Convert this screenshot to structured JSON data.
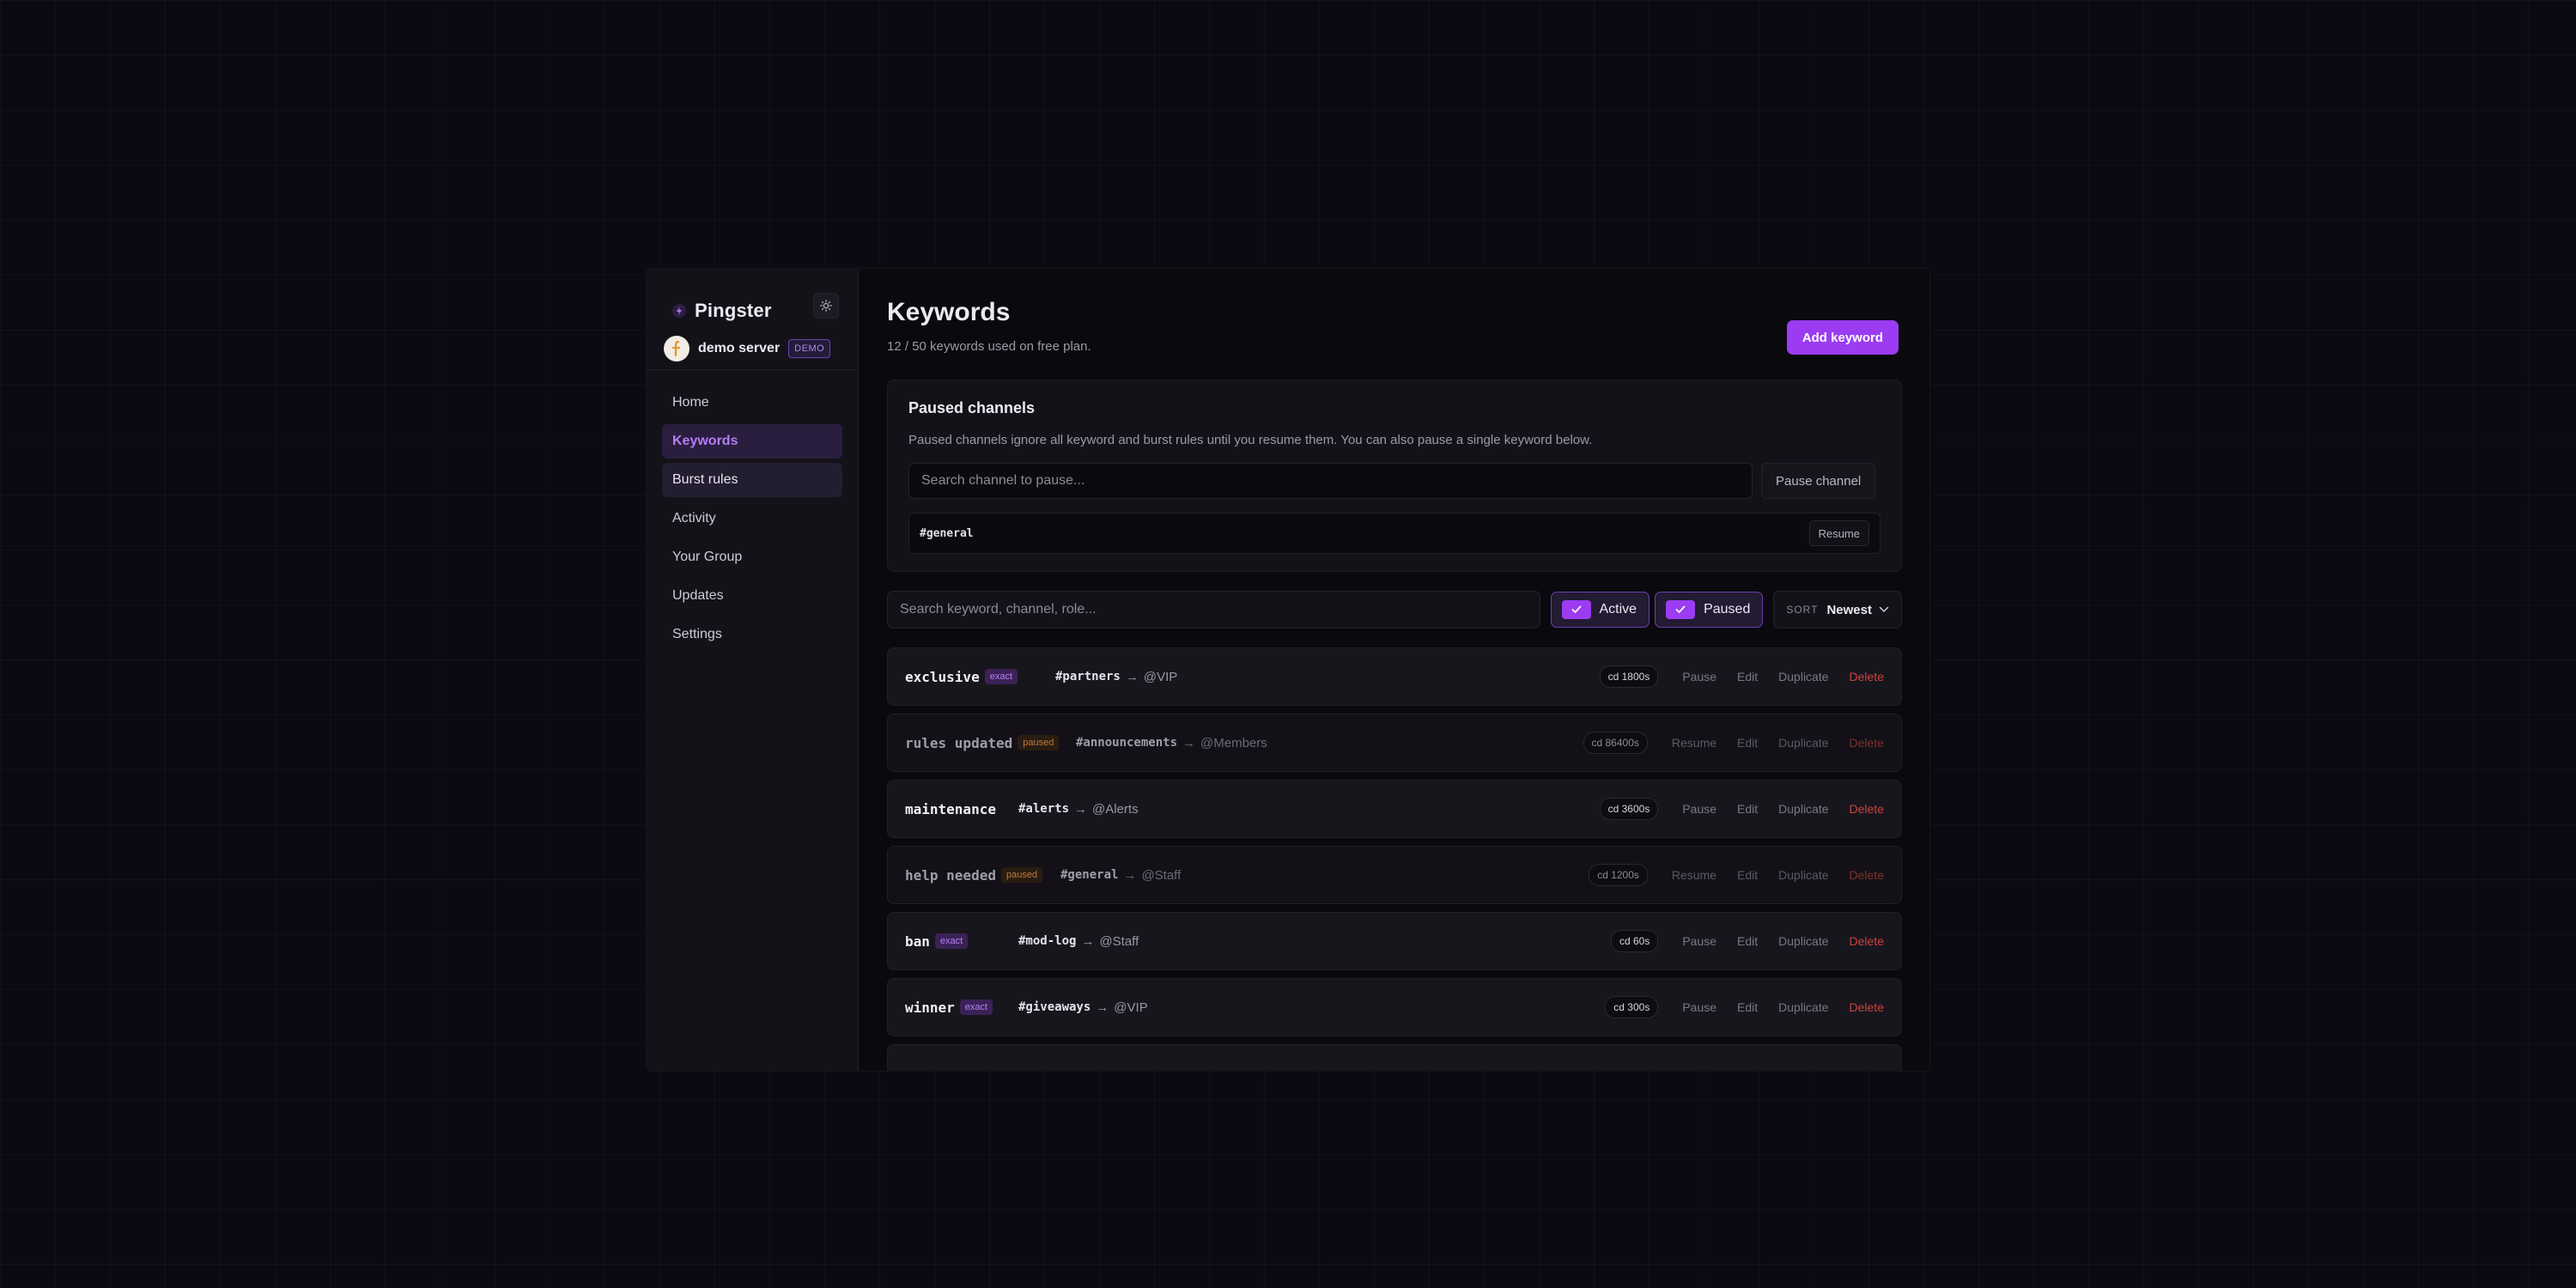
{
  "brand": {
    "name": "Pingster"
  },
  "server": {
    "name": "demo server",
    "badge": "DEMO"
  },
  "nav": [
    {
      "label": "Home"
    },
    {
      "label": "Keywords"
    },
    {
      "label": "Burst rules"
    },
    {
      "label": "Activity"
    },
    {
      "label": "Your Group"
    },
    {
      "label": "Updates"
    },
    {
      "label": "Settings"
    }
  ],
  "header": {
    "title": "Keywords",
    "subtitle": "12 / 50 keywords used on free plan.",
    "add_button": "Add keyword"
  },
  "paused_channels": {
    "title": "Paused channels",
    "description": "Paused channels ignore all keyword and burst rules until you resume them. You can also pause a single keyword below.",
    "input_placeholder": "Search channel to pause...",
    "pause_button": "Pause channel",
    "channels": [
      {
        "name": "#general",
        "resume_label": "Resume"
      }
    ]
  },
  "filters": {
    "search_placeholder": "Search keyword, channel, role...",
    "active_label": "Active",
    "paused_label": "Paused",
    "active_checked": true,
    "paused_checked": true,
    "sort_label": "SORT",
    "sort_value": "Newest"
  },
  "keywords": [
    {
      "word": "exclusive",
      "tag": "exact",
      "channel": "#partners",
      "arrow": "→",
      "role": "@VIP",
      "cooldown": "cd 1800s",
      "toggle": "Pause",
      "edit": "Edit",
      "duplicate": "Duplicate",
      "delete": "Delete"
    },
    {
      "word": "rules updated",
      "tag": "paused",
      "channel": "#announcements",
      "arrow": "→",
      "role": "@Members",
      "cooldown": "cd 86400s",
      "toggle": "Resume",
      "edit": "Edit",
      "duplicate": "Duplicate",
      "delete": "Delete"
    },
    {
      "word": "maintenance",
      "tag": "",
      "channel": "#alerts",
      "arrow": "→",
      "role": "@Alerts",
      "cooldown": "cd 3600s",
      "toggle": "Pause",
      "edit": "Edit",
      "duplicate": "Duplicate",
      "delete": "Delete"
    },
    {
      "word": "help needed",
      "tag": "paused",
      "channel": "#general",
      "arrow": "→",
      "role": "@Staff",
      "cooldown": "cd 1200s",
      "toggle": "Resume",
      "edit": "Edit",
      "duplicate": "Duplicate",
      "delete": "Delete"
    },
    {
      "word": "ban",
      "tag": "exact",
      "channel": "#mod-log",
      "arrow": "→",
      "role": "@Staff",
      "cooldown": "cd 60s",
      "toggle": "Pause",
      "edit": "Edit",
      "duplicate": "Duplicate",
      "delete": "Delete"
    },
    {
      "word": "winner",
      "tag": "exact",
      "channel": "#giveaways",
      "arrow": "→",
      "role": "@VIP",
      "cooldown": "cd 300s",
      "toggle": "Pause",
      "edit": "Edit",
      "duplicate": "Duplicate",
      "delete": "Delete"
    }
  ],
  "colors": {
    "accent": "#9b3cf2",
    "background": "#0b0912",
    "danger": "#c8443f",
    "paused_tag": "#c07a3a"
  },
  "icons": {
    "brand": "lightning-bolt-icon",
    "theme": "sun-icon",
    "check": "check-icon",
    "sort": "chevron-down-icon"
  }
}
